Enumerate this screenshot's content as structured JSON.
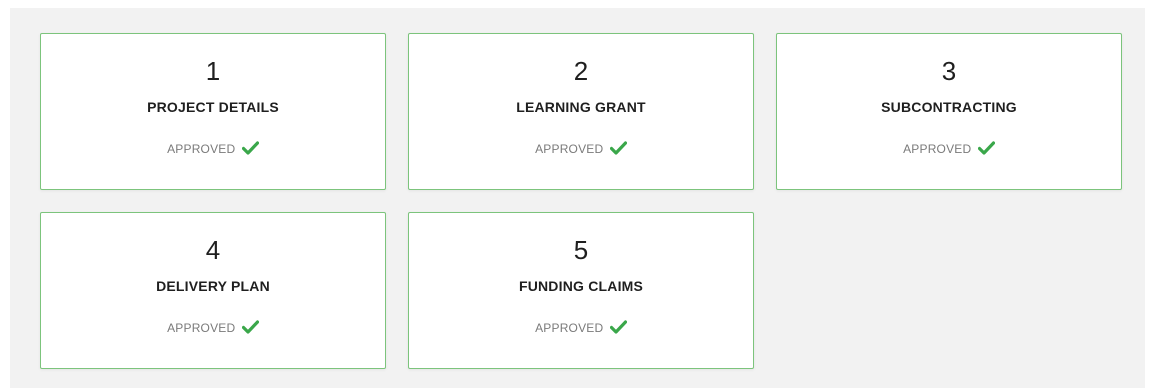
{
  "steps": [
    {
      "number": "1",
      "title": "PROJECT DETAILS",
      "status": "APPROVED"
    },
    {
      "number": "2",
      "title": "LEARNING GRANT",
      "status": "APPROVED"
    },
    {
      "number": "3",
      "title": "SUBCONTRACTING",
      "status": "APPROVED"
    },
    {
      "number": "4",
      "title": "DELIVERY PLAN",
      "status": "APPROVED"
    },
    {
      "number": "5",
      "title": "FUNDING CLAIMS",
      "status": "APPROVED"
    }
  ],
  "colors": {
    "card_border": "#7cc47c",
    "check": "#3aa74a",
    "status_text": "#7a7a7a",
    "panel_bg": "#f2f2f2"
  },
  "icons": {
    "status_icon": "check-icon"
  }
}
